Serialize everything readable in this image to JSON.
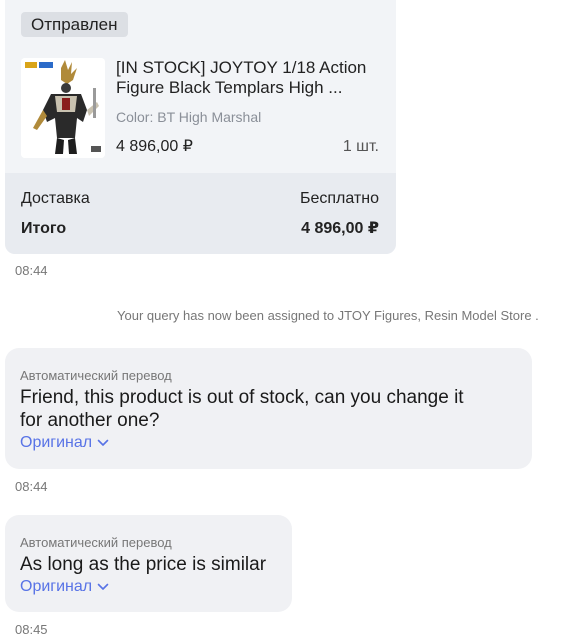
{
  "order": {
    "status": "Отправлен",
    "product": {
      "title": "[IN STOCK] JOYTOY 1/18 Action Figure Black Templars High ...",
      "color": "Color: BT High Marshal",
      "price": "4 896,00 ₽",
      "quantity": "1 шт."
    },
    "delivery_label": "Доставка",
    "delivery_value": "Бесплатно",
    "total_label": "Итого",
    "total_value": "4 896,00 ₽"
  },
  "timestamps": [
    "08:44",
    "08:44",
    "08:45"
  ],
  "system_message": "Your query has now been assigned to JTOY Figures, Resin Model Store .",
  "messages": [
    {
      "auto_label": "Автоматический перевод",
      "text_lines": [
        "Friend, this product is out of stock, can you change it",
        "for another one?"
      ],
      "original_link": "Оригинал"
    },
    {
      "auto_label": "Автоматический перевод",
      "text_lines": [
        "As long as the price is similar"
      ],
      "original_link": "Оригинал"
    }
  ],
  "colors": {
    "card_bg": "#f2f4f7",
    "totals_bg": "#e8ebf0",
    "bubble_bg": "#f0f1f4",
    "link": "#5873e6",
    "muted": "#777777"
  },
  "icons": {
    "original_chevron": "chevron-down-icon"
  }
}
